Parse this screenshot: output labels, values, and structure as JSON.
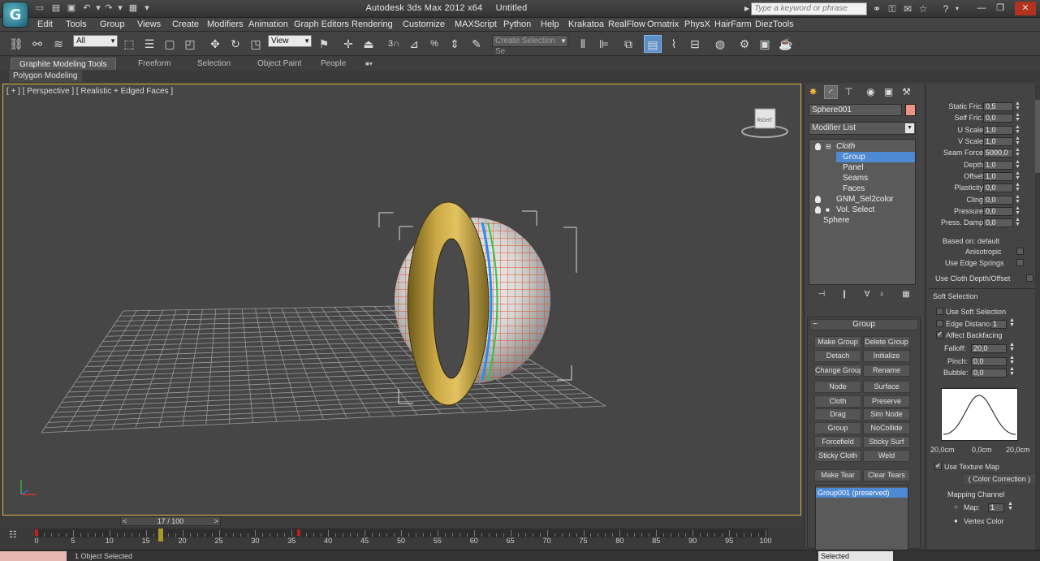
{
  "titlebar": {
    "app_name": "Autodesk 3ds Max  2012 x64",
    "document": "Untitled",
    "search_placeholder": "Type a keyword or phrase"
  },
  "menu": [
    "Edit",
    "Tools",
    "Group",
    "Views",
    "Create",
    "Modifiers",
    "Animation",
    "Graph Editors",
    "Rendering",
    "Customize",
    "MAXScript",
    "Python",
    "Help",
    "Krakatoa",
    "RealFlow",
    "Ornatrix",
    "PhysX",
    "HairFarm",
    "DiezTools"
  ],
  "toolbar": {
    "filter_value": "All",
    "refcoord_value": "View",
    "named_selection_placeholder": "Create Selection Se",
    "snap_label": "3",
    "angle_label": "n"
  },
  "ribbon": {
    "tabs": [
      "Graphite Modeling Tools",
      "Freeform",
      "Selection",
      "Object Paint",
      "People"
    ],
    "sub_label": "Polygon Modeling"
  },
  "viewport": {
    "label": "[ + ] [ Perspective ] [ Realistic + Edged Faces ]",
    "viewcube_label": "RIGHT"
  },
  "command_panel": {
    "object_name": "Sphere001",
    "object_color": "#ef9386",
    "modifier_list_label": "Modifier List",
    "stack": [
      {
        "label": "Cloth",
        "italic": true
      },
      {
        "label": "Group",
        "selected": true
      },
      {
        "label": "Panel"
      },
      {
        "label": "Seams"
      },
      {
        "label": "Faces"
      },
      {
        "label": "GNM_Sel2color"
      },
      {
        "label": "Vol. Select"
      },
      {
        "label": "Sphere"
      }
    ],
    "group_rollout_title": "Group",
    "group_buttons": [
      "Make Group",
      "Delete Group",
      "Detach",
      "Initialize",
      "Change Group",
      "Rename",
      "Node",
      "Surface",
      "Cloth",
      "Preserve",
      "Drag",
      "Sim Node",
      "Group",
      "NoCollide",
      "Forcefield",
      "Sticky Surf",
      "Sticky Cloth",
      "Weld",
      "Make Tear",
      "Clear Tears"
    ],
    "group_list_item": "Group001 (preserved)"
  },
  "params": {
    "rows": [
      {
        "label": "Static Fric.",
        "value": "0,5"
      },
      {
        "label": "Self Fric.",
        "value": "0,0"
      },
      {
        "label": "U Scale",
        "value": "1,0"
      },
      {
        "label": "V Scale",
        "value": "1,0"
      },
      {
        "label": "Seam Force",
        "value": "5000,0"
      },
      {
        "label": "Depth",
        "value": "1,0"
      },
      {
        "label": "Offset",
        "value": "1,0"
      },
      {
        "label": "Plasticity",
        "value": "0,0"
      },
      {
        "label": "Cling",
        "value": "0,0"
      },
      {
        "label": "Pressure",
        "value": "0,0"
      },
      {
        "label": "Press. Damp",
        "value": "0,0"
      }
    ],
    "based_on_label": "Based on:",
    "based_on_value": "default",
    "anisotropic": "Anisotropic",
    "use_edge_springs": "Use Edge Springs",
    "use_cloth_depth": "Use Cloth Depth/Offset",
    "soft_selection_title": "Soft Selection",
    "use_soft_selection": "Use Soft Selection",
    "edge_distance_label": "Edge Distance:",
    "edge_distance_value": "1",
    "affect_backfacing": "Affect Backfacing",
    "falloff_label": "Falloff:",
    "falloff_value": "20,0",
    "pinch_label": "Pinch:",
    "pinch_value": "0,0",
    "bubble_label": "Bubble:",
    "bubble_value": "0,0",
    "curve_left": "20,0cm",
    "curve_mid": "0,0cm",
    "curve_right": "20,0cm",
    "use_texture_map": "Use Texture Map",
    "color_correction": "( Color Correction )",
    "mapping_channel": "Mapping Channel",
    "map_label": "Map:",
    "map_value": "1",
    "vertex_color": "Vertex Color"
  },
  "timeline": {
    "frame_display": "17 / 100",
    "current_frame": 17,
    "ticks": [
      0,
      5,
      10,
      15,
      20,
      25,
      30,
      35,
      40,
      45,
      50,
      55,
      60,
      65,
      70,
      75,
      80,
      85,
      90,
      95,
      100
    ]
  },
  "status": {
    "text": "1 Object Selected",
    "mode_value": "Selected"
  }
}
